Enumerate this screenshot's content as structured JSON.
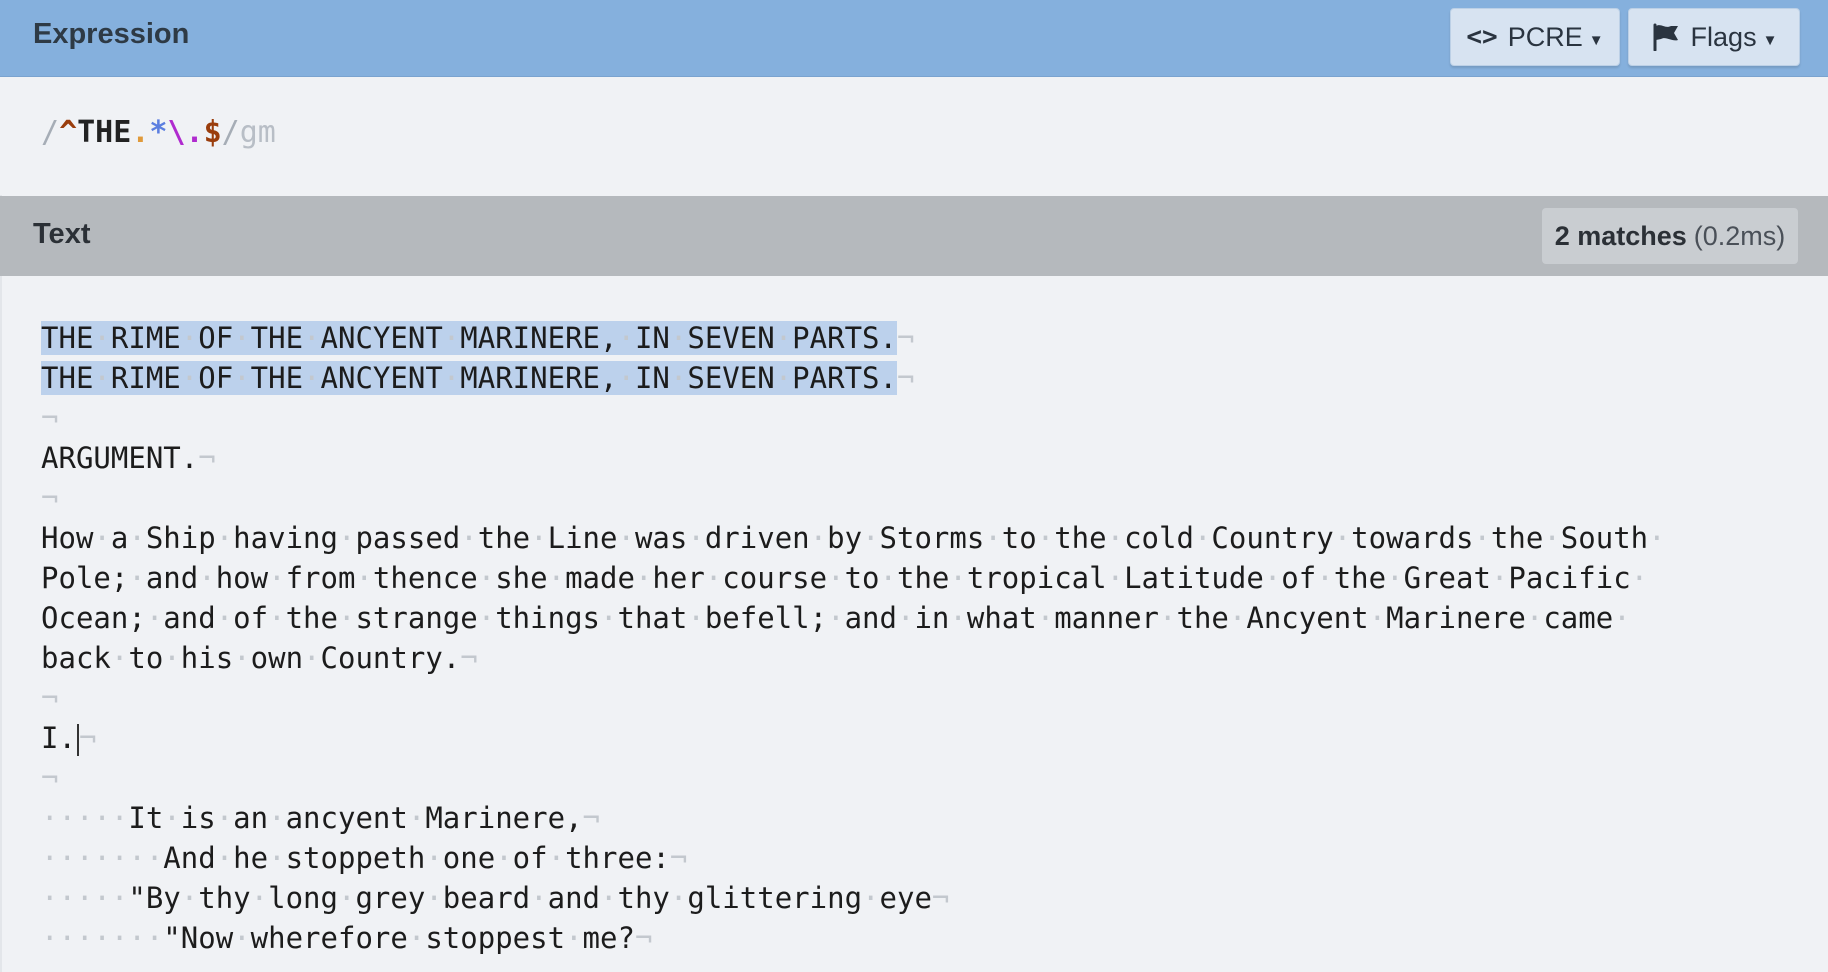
{
  "expression_panel": {
    "title": "Expression",
    "flavor_button": {
      "icon": "<>",
      "label": "PCRE"
    },
    "flags_button": {
      "label": "Flags"
    },
    "expression": {
      "open_delim": "/",
      "anchor_start": "^",
      "literal": "THE",
      "any_char": ".",
      "quantifier": "*",
      "escaped_dot": "\\.",
      "anchor_end": "$",
      "close_delim": "/",
      "flags": "gm"
    }
  },
  "text_panel": {
    "title": "Text",
    "match_count": "2 matches",
    "match_time": "(0.2ms)",
    "lines": [
      {
        "text": "THE RIME OF THE ANCYENT MARINERE, IN SEVEN PARTS.",
        "match": true
      },
      {
        "text": "THE RIME OF THE ANCYENT MARINERE, IN SEVEN PARTS.",
        "match": true
      },
      {
        "text": "",
        "match": false
      },
      {
        "text": "ARGUMENT.",
        "match": false
      },
      {
        "text": "",
        "match": false
      },
      {
        "text": "How a Ship having passed the Line was driven by Storms to the cold Country towards the South ",
        "match": false,
        "wrapped": true
      },
      {
        "text": "Pole; and how from thence she made her course to the tropical Latitude of the Great Pacific ",
        "match": false,
        "wrapped": true
      },
      {
        "text": "Ocean; and of the strange things that befell; and in what manner the Ancyent Marinere came ",
        "match": false,
        "wrapped": true
      },
      {
        "text": "back to his own Country.",
        "match": false
      },
      {
        "text": "",
        "match": false
      },
      {
        "text": "I.",
        "match": false,
        "cursor": true
      },
      {
        "text": "",
        "match": false
      },
      {
        "text": "     It is an ancyent Marinere,",
        "match": false
      },
      {
        "text": "       And he stoppeth one of three:",
        "match": false
      },
      {
        "text": "     \"By thy long grey beard and thy glittering eye",
        "match": false
      },
      {
        "text": "       \"Now wherefore stoppest me?",
        "match": false
      }
    ]
  },
  "colors": {
    "expression_header": "#85b0dd",
    "text_header": "#b5b9bd",
    "match_highlight": "#bcd1ec",
    "background": "#f0f2f5"
  },
  "icons": {
    "flavor": "code-brackets-icon",
    "flags": "flag-icon",
    "dropdown": "caret-down-icon"
  }
}
